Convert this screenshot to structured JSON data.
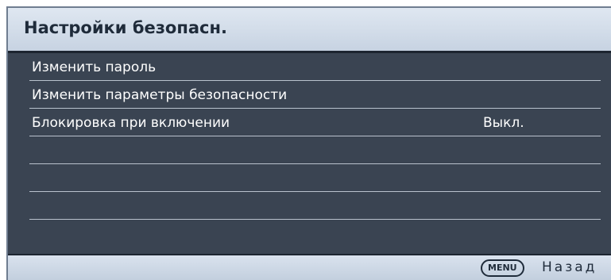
{
  "header": {
    "title": "Настройки безопасн."
  },
  "menu": {
    "items": [
      {
        "label": "Изменить пароль",
        "value": ""
      },
      {
        "label": "Изменить параметры безопасности",
        "value": ""
      },
      {
        "label": "Блокировка при включении",
        "value": "Выкл."
      },
      {
        "label": "",
        "value": ""
      },
      {
        "label": "",
        "value": ""
      },
      {
        "label": "",
        "value": ""
      }
    ]
  },
  "footer": {
    "menu_key": "MENU",
    "back_label": "Назад"
  },
  "colors": {
    "panel_background": "#3a4452",
    "header_background": "#d4deea",
    "text": "#ffffff",
    "header_text": "#1f2b3a"
  }
}
